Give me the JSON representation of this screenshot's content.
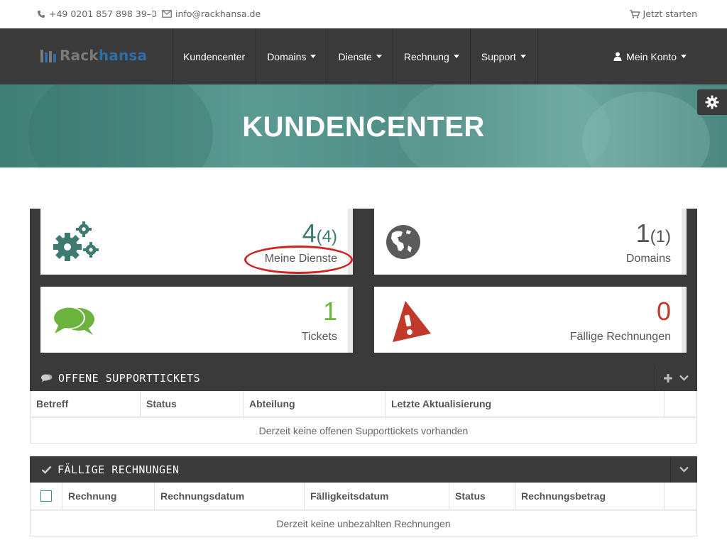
{
  "topbar": {
    "phone": "+49 0201 857 898 39–0",
    "email": "info@rackhansa.de",
    "cart_label": "Jetzt starten"
  },
  "brand": {
    "logo_part1": "Rack",
    "logo_part2": "hansa"
  },
  "nav": {
    "items": [
      {
        "label": "Kundencenter",
        "dropdown": false
      },
      {
        "label": "Domains",
        "dropdown": true
      },
      {
        "label": "Dienste",
        "dropdown": true
      },
      {
        "label": "Rechnung",
        "dropdown": true
      },
      {
        "label": "Support",
        "dropdown": true
      }
    ],
    "account_label": "Mein Konto"
  },
  "hero": {
    "title": "KUNDENCENTER"
  },
  "tiles": {
    "services": {
      "count": "4",
      "total": "(4)",
      "label": "Meine Dienste",
      "color": "#3d7a72"
    },
    "domains": {
      "count": "1",
      "total": "(1)",
      "label": "Domains",
      "color": "#555555"
    },
    "tickets": {
      "count": "1",
      "label": "Tickets",
      "color": "#6cb33e"
    },
    "invoices": {
      "count": "0",
      "label": "Fällige Rechnungen",
      "color": "#c0392b"
    }
  },
  "tickets_panel": {
    "title": "OFFENE SUPPORTTICKETS",
    "columns": [
      "Betreff",
      "Status",
      "Abteilung",
      "Letzte Aktualisierung"
    ],
    "empty_text": "Derzeit keine offenen Supporttickets vorhanden"
  },
  "invoices_panel": {
    "title": "FÄLLIGE RECHNUNGEN",
    "columns": [
      "Rechnung",
      "Rechnungsdatum",
      "Fälligkeitsdatum",
      "Status",
      "Rechnungsbetrag"
    ],
    "empty_text": "Derzeit keine unbezahlten Rechnungen"
  },
  "colors": {
    "navbar": "#3a3a3a",
    "brand_blue": "#2e6ea6",
    "accent_teal": "#3d7a72",
    "annotation_red": "#d42222"
  }
}
